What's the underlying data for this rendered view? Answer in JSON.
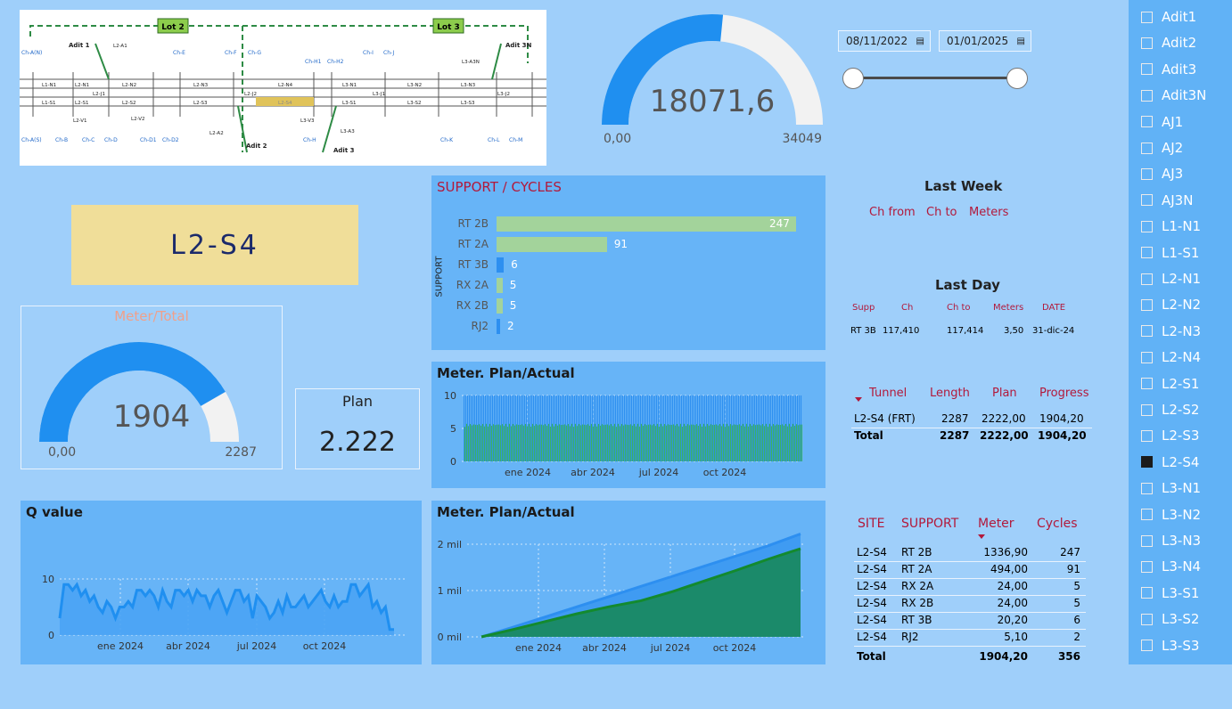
{
  "map": {
    "lot_labels": [
      "Lot 2",
      "Lot 3"
    ],
    "adit_labels": [
      "Adit 1",
      "Adit 2",
      "Adit 3",
      "Adit 3N"
    ],
    "ch_labels": [
      "Ch-A(N)",
      "Ch-E",
      "Ch-F",
      "Ch-G",
      "Ch-H1",
      "Ch-H2",
      "Ch-I",
      "Ch-J",
      "Ch-A(S)",
      "Ch-B",
      "Ch-C",
      "Ch-D",
      "Ch-D1",
      "Ch-D2",
      "Ch-H",
      "Ch-K",
      "Ch-L",
      "Ch-M"
    ],
    "tunnel_labels": [
      "L1-N1",
      "L2-N1",
      "L2-N2",
      "L2-N3",
      "L2-N4",
      "L3-N1",
      "L3-N2",
      "L3-N3",
      "L1-S1",
      "L2-S1",
      "L2-S2",
      "L2-S3",
      "L2-S4",
      "L3-S1",
      "L3-S2",
      "L3-S3",
      "L2-J1",
      "L2-J2",
      "L3-J1",
      "L3-J2",
      "L2-A1",
      "L2-A2",
      "L2-V1",
      "L2-V2",
      "L3-A3",
      "L3-A3N",
      "L3-V3"
    ]
  },
  "top_gauge": {
    "value": "18071,6",
    "min": "0,00",
    "max": "34049",
    "fraction": 0.531
  },
  "selected_tunnel": "L2-S4",
  "meter_total": {
    "title": "Meter/Total",
    "value": "1904",
    "min": "0,00",
    "max": "2287",
    "fraction": 0.833
  },
  "plan": {
    "title": "Plan",
    "value": "2.222"
  },
  "support_cycles": {
    "title": "SUPPORT / CYCLES",
    "axis_title": "SUPPORT",
    "bars": [
      {
        "label": "RT 2B",
        "value": "247",
        "n": 247,
        "color": "#a3d39b"
      },
      {
        "label": "RT 2A",
        "value": "91",
        "n": 91,
        "color": "#a3d39b"
      },
      {
        "label": "RT 3B",
        "value": "6",
        "n": 6,
        "color": "#2d8ff0"
      },
      {
        "label": "RX 2A",
        "value": "5",
        "n": 5,
        "color": "#a3d39b"
      },
      {
        "label": "RX 2B",
        "value": "5",
        "n": 5,
        "color": "#a3d39b"
      },
      {
        "label": "RJ2",
        "value": "2",
        "n": 2,
        "color": "#2d8ff0"
      }
    ]
  },
  "chart_data": [
    {
      "type": "bar",
      "title": "Meter. Plan/Actual",
      "y_ticks": [
        "10",
        "5",
        "0"
      ],
      "x_ticks": [
        "ene 2024",
        "abr 2024",
        "jul 2024",
        "oct 2024"
      ],
      "ylim": [
        0,
        10
      ],
      "series": [
        {
          "name": "Plan",
          "color": "#2d8ff0",
          "approx_value": 10
        },
        {
          "name": "Actual",
          "color": "#3cb55c",
          "approx_value": 5.7
        }
      ]
    },
    {
      "type": "line",
      "title": "Q value",
      "y_ticks": [
        "10",
        "0"
      ],
      "x_ticks": [
        "ene 2024",
        "abr 2024",
        "jul 2024",
        "oct 2024"
      ],
      "ylim": [
        0,
        12
      ],
      "values": [
        3,
        9,
        9,
        8,
        9,
        7,
        8,
        6,
        7,
        5,
        4,
        6,
        5,
        3,
        5,
        5,
        6,
        5,
        8,
        8,
        7,
        8,
        7,
        5,
        8,
        6,
        5,
        8,
        8,
        7,
        8,
        6,
        8,
        7,
        7,
        5,
        7,
        8,
        6,
        4,
        6,
        8,
        8,
        6,
        7,
        3,
        7,
        6,
        5,
        3,
        4,
        6,
        4,
        7,
        5,
        5,
        6,
        7,
        5,
        6,
        7,
        8,
        6,
        5,
        7,
        5,
        6,
        6,
        9,
        9,
        7,
        8,
        9,
        5,
        6,
        4,
        5,
        1,
        1
      ]
    },
    {
      "type": "area",
      "title": "Meter. Plan/Actual",
      "y_ticks": [
        "2 mil",
        "1 mil",
        "0 mil"
      ],
      "x_ticks": [
        "ene 2024",
        "abr 2024",
        "jul 2024",
        "oct 2024"
      ],
      "ylim": [
        0,
        2400
      ],
      "series": [
        {
          "name": "Plan",
          "color": "#2d8ff0",
          "values": [
            0,
            210,
            430,
            650,
            870,
            1090,
            1310,
            1530,
            1750,
            1970,
            2222
          ]
        },
        {
          "name": "Actual",
          "color": "#138a2e",
          "values": [
            0,
            160,
            330,
            500,
            650,
            780,
            980,
            1210,
            1440,
            1680,
            1904
          ]
        }
      ]
    }
  ],
  "date_range": {
    "start": "08/11/2022",
    "end": "01/01/2025"
  },
  "last_week": {
    "title": "Last Week",
    "headers": [
      "Ch from",
      "Ch to",
      "Meters"
    ]
  },
  "last_day": {
    "title": "Last Day",
    "headers": [
      "Supp",
      "Ch",
      "Ch to",
      "Meters",
      "DATE"
    ],
    "row": [
      "RT 3B",
      "117,410",
      "117,414",
      "3,50",
      "31-dic-24"
    ]
  },
  "tunnel_table": {
    "headers": [
      "Tunnel",
      "Length",
      "Plan",
      "Progress"
    ],
    "row": [
      "L2-S4 (FRT)",
      "2287",
      "2222,00",
      "1904,20"
    ],
    "total": [
      "Total",
      "2287",
      "2222,00",
      "1904,20"
    ]
  },
  "site_table": {
    "headers": [
      "SITE",
      "SUPPORT",
      "Meter",
      "Cycles"
    ],
    "rows": [
      [
        "L2-S4",
        "RT 2B",
        "1336,90",
        "247"
      ],
      [
        "L2-S4",
        "RT 2A",
        "494,00",
        "91"
      ],
      [
        "L2-S4",
        "RX 2A",
        "24,00",
        "5"
      ],
      [
        "L2-S4",
        "RX 2B",
        "24,00",
        "5"
      ],
      [
        "L2-S4",
        "RT 3B",
        "20,20",
        "6"
      ],
      [
        "L2-S4",
        "RJ2",
        "5,10",
        "2"
      ]
    ],
    "total": [
      "Total",
      "1904,20",
      "356"
    ]
  },
  "slicer": {
    "items": [
      "Adit1",
      "Adit2",
      "Adit3",
      "Adit3N",
      "AJ1",
      "AJ2",
      "AJ3",
      "AJ3N",
      "L1-N1",
      "L1-S1",
      "L2-N1",
      "L2-N2",
      "L2-N3",
      "L2-N4",
      "L2-S1",
      "L2-S2",
      "L2-S3",
      "L2-S4",
      "L3-N1",
      "L3-N2",
      "L3-N3",
      "L3-N4",
      "L3-S1",
      "L3-S2",
      "L3-S3"
    ],
    "selected": "L2-S4"
  }
}
